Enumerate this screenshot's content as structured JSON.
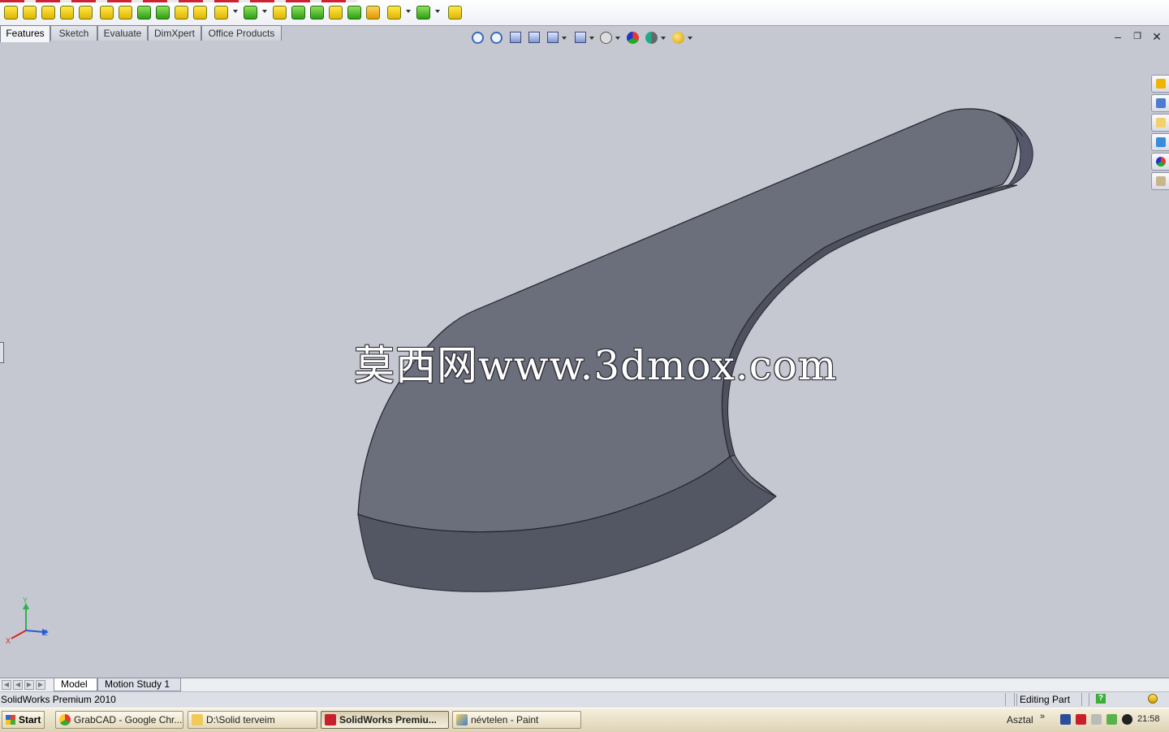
{
  "command_tabs": [
    "Features",
    "Sketch",
    "Evaluate",
    "DimXpert",
    "Office Products"
  ],
  "bottom_tabs": [
    "Model",
    "Motion Study 1"
  ],
  "status_bar": {
    "app_text": "SolidWorks Premium 2010",
    "mode": "Editing Part"
  },
  "watermark": "莫西网www.3dmox.com",
  "triad": {
    "x": "X",
    "y": "Y",
    "z": "Z"
  },
  "taskbar": {
    "start": "Start",
    "tasks": [
      {
        "label": "GrabCAD - Google Chr...",
        "icon": "chrome-icon"
      },
      {
        "label": "D:\\Solid terveim",
        "icon": "folder-icon"
      },
      {
        "label": "SolidWorks Premiu...",
        "icon": "solidworks-icon",
        "active": true
      },
      {
        "label": "névtelen - Paint",
        "icon": "paint-icon"
      }
    ],
    "tray_label": "Asztal",
    "clock": "21:58"
  },
  "window_controls": [
    "minimize-icon",
    "restore-icon",
    "close-icon"
  ],
  "colors": {
    "viewport": "#c5c8d1",
    "model_face": "#6b6e7b",
    "model_side": "#545764",
    "model_edge": "#24252c"
  }
}
